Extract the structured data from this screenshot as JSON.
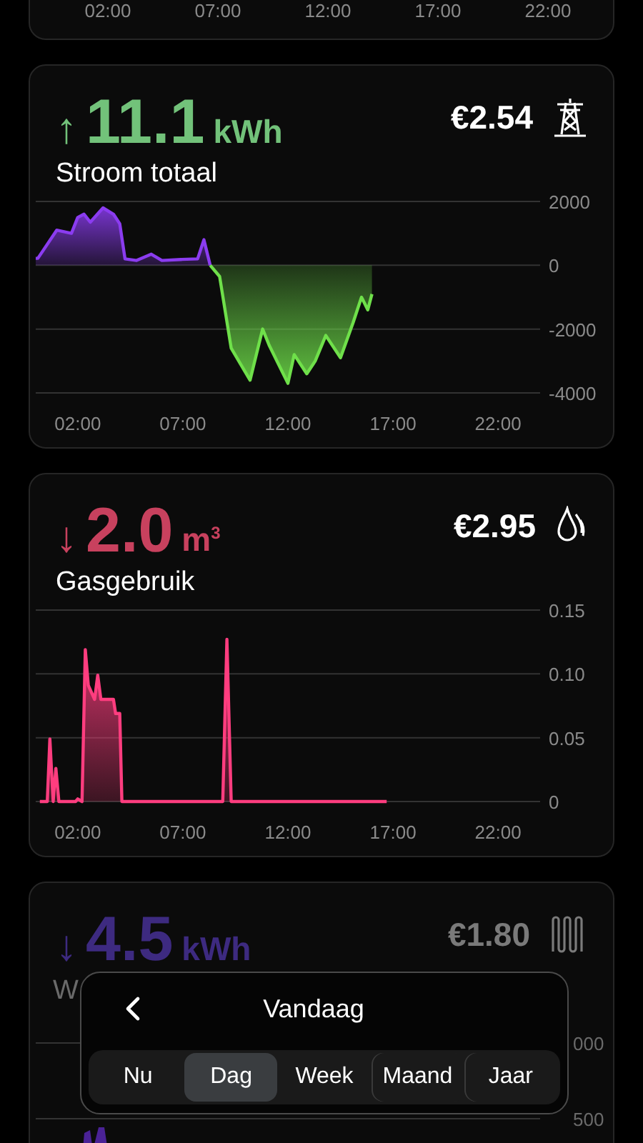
{
  "cards": [
    {
      "kind": "axis_only",
      "x_labels": [
        "02:00",
        "07:00",
        "12:00",
        "17:00",
        "22:00"
      ]
    },
    {
      "kind": "chart",
      "arrow": "↑",
      "value": "11.1",
      "unit": "kWh",
      "price": "€2.54",
      "title": "Stroom totaal",
      "color": "#72c27a",
      "chart_data": {
        "type": "area",
        "x": [
          0,
          0.1,
          1.0,
          1.7,
          2.0,
          2.3,
          2.6,
          3.2,
          3.7,
          4.0,
          4.25,
          4.8,
          5.5,
          6.0,
          6.9,
          7.7,
          8.0,
          8.3,
          8.75,
          9.3,
          10.2,
          10.8,
          11.1,
          12.0,
          12.3,
          12.9,
          13.3,
          13.8,
          14.5,
          15.1,
          15.5,
          15.8,
          16.0
        ],
        "series": [
          {
            "color": "#8b3cf0",
            "values": [
              220,
              220,
              1100,
              1000,
              1500,
              1600,
              1350,
              1800,
              1600,
              1300,
              200,
              150,
              350,
              150,
              180,
              200,
              800,
              0,
              null,
              null,
              null,
              null,
              null,
              null,
              null,
              null,
              null,
              null,
              null,
              null,
              null,
              null,
              null
            ]
          },
          {
            "color": "#6fe04a",
            "values": [
              null,
              null,
              null,
              null,
              null,
              null,
              null,
              null,
              null,
              null,
              null,
              null,
              null,
              null,
              null,
              null,
              null,
              0,
              -350,
              -2600,
              -3600,
              -2000,
              -2500,
              -3700,
              -2800,
              -3400,
              -3000,
              -2200,
              -2900,
              -1800,
              -1000,
              -1400,
              -900
            ]
          }
        ],
        "xlim": [
          0,
          24
        ],
        "ylim": [
          -4000,
          2000
        ],
        "xticks": [
          {
            "value": 2,
            "label": "02:00"
          },
          {
            "value": 7,
            "label": "07:00"
          },
          {
            "value": 12,
            "label": "12:00"
          },
          {
            "value": 17,
            "label": "17:00"
          },
          {
            "value": 22,
            "label": "22:00"
          }
        ],
        "yticks": [
          -4000,
          -2000,
          0,
          2000
        ]
      }
    },
    {
      "kind": "chart",
      "arrow": "↓",
      "value": "2.0",
      "unit": "m$^{3}$",
      "price": "€2.95",
      "title": "Gasgebruik",
      "color": "#c8415e",
      "chart_data": {
        "type": "area",
        "x": [
          0.2,
          0.55,
          0.67,
          0.83,
          0.96,
          1.1,
          1.9,
          2.0,
          2.2,
          2.36,
          2.5,
          2.8,
          2.95,
          3.1,
          3.7,
          3.8,
          4.0,
          4.1,
          8.9,
          9.1,
          9.3,
          16.7
        ],
        "series": [
          {
            "color": "#ff3d7f",
            "values": [
              0,
              0,
              0.049,
              0,
              0.026,
              0,
              0,
              0.002,
              0,
              0.119,
              0.091,
              0.08,
              0.099,
              0.08,
              0.08,
              0.069,
              0.069,
              0,
              0,
              0.127,
              0,
              0
            ]
          }
        ],
        "xlim": [
          0,
          24
        ],
        "ylim": [
          0,
          0.15
        ],
        "xticks": [
          {
            "value": 2,
            "label": "02:00"
          },
          {
            "value": 7,
            "label": "07:00"
          },
          {
            "value": 12,
            "label": "12:00"
          },
          {
            "value": 17,
            "label": "17:00"
          },
          {
            "value": 22,
            "label": "22:00"
          }
        ],
        "yticks": [
          {
            "value": 0,
            "label": "0"
          },
          {
            "value": 0.05,
            "label": "0.05"
          },
          {
            "value": 0.1,
            "label": "0.10"
          },
          {
            "value": 0.15,
            "label": "0.15"
          }
        ]
      }
    },
    {
      "kind": "dimmed",
      "arrow": "↓",
      "value": "4.5",
      "unit": "kWh",
      "price": "€1.80",
      "title": "W",
      "color": "#3d2a80",
      "tick_labels": [
        "000",
        "500"
      ]
    }
  ],
  "period_picker": {
    "title": "Vandaag",
    "options": [
      {
        "label": "Nu",
        "selected": false
      },
      {
        "label": "Dag",
        "selected": true
      },
      {
        "label": "Week",
        "selected": false
      },
      {
        "label": "Maand",
        "selected": false
      },
      {
        "label": "Jaar",
        "selected": false
      }
    ]
  }
}
